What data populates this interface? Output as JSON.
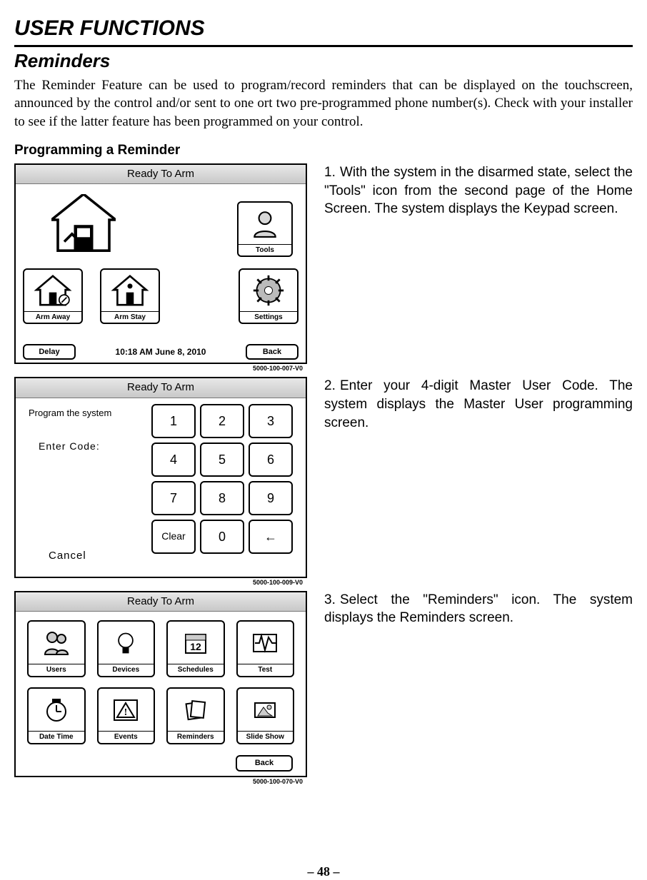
{
  "page": {
    "title": "USER FUNCTIONS",
    "section": "Reminders",
    "intro": "The Reminder Feature can be used to program/record reminders that can be displayed on the touchscreen, announced by the control and/or sent to one ort two pre-programmed phone number(s). Check with your installer to see if the latter feature has been programmed on your control.",
    "subheading": "Programming a Reminder",
    "pagenum": "– 48 –"
  },
  "steps": {
    "s1": "With the system in the disarmed state, select the \"Tools\" icon from the second page of the Home Screen. The system displays the Keypad screen.",
    "s2": "Enter your 4-digit Master User Code. The system displays the Master User programming screen.",
    "s3": "Select the \"Reminders\" icon. The system displays the Reminders screen.",
    "n1": "1.",
    "n2": "2.",
    "n3": "3."
  },
  "fig1": {
    "title": "Ready To Arm",
    "tools": "Tools",
    "arm_away": "Arm Away",
    "arm_stay": "Arm Stay",
    "settings": "Settings",
    "delay": "Delay",
    "timestamp": "10:18 AM  June 8,  2010",
    "back": "Back",
    "code": "5000-100-007-V0"
  },
  "fig2": {
    "title": "Ready To Arm",
    "program": "Program the system",
    "enter": "Enter Code:",
    "cancel": "Cancel",
    "keys": [
      "1",
      "2",
      "3",
      "4",
      "5",
      "6",
      "7",
      "8",
      "9",
      "Clear",
      "0",
      "←"
    ],
    "code": "5000-100-009-V0"
  },
  "fig3": {
    "title": "Ready To Arm",
    "items": [
      "Users",
      "Devices",
      "Schedules",
      "Test",
      "Date Time",
      "Events",
      "Reminders",
      "Slide Show"
    ],
    "back": "Back",
    "code": "5000-100-070-V0"
  }
}
